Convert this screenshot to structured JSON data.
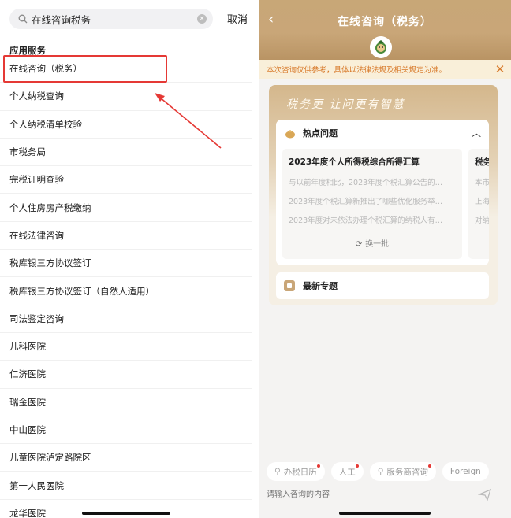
{
  "search": {
    "query": "在线咨询税务",
    "cancel_label": "取消"
  },
  "results": {
    "section_title": "应用服务",
    "items": [
      "在线咨询（税务）",
      "个人纳税查询",
      "个人纳税清单校验",
      "市税务局",
      "完税证明查验",
      "个人住房房产税缴纳",
      "在线法律咨询",
      "税库银三方协议签订",
      "税库银三方协议签订（自然人适用）",
      "司法鉴定咨询",
      "儿科医院",
      "仁济医院",
      "瑞金医院",
      "中山医院",
      "儿童医院泸定路院区",
      "第一人民医院",
      "龙华医院"
    ]
  },
  "chat": {
    "title": "在线咨询（税务）",
    "notice": "本次咨询仅供参考，具体以法律法规及相关规定为准。",
    "slogan": "税务更 让问更有智慧",
    "hot": {
      "title": "热点问题",
      "question_head": "2023年度个人所得税综合所得汇算",
      "questions": [
        "与以前年度相比，2023年度个税汇算公告的…",
        "2023年度个税汇算新推出了哪些优化服务举…",
        "2023年度对未依法办理个税汇算的纳税人有…"
      ],
      "refresh_label": "换一批",
      "second_head": "税务",
      "second_lines": [
        "本市",
        "上海",
        "对纳"
      ]
    },
    "topic_title": "最新专题",
    "chips": [
      "办税日历",
      "人工",
      "服务商咨询",
      "Foreign"
    ],
    "input_placeholder": "请输入咨询的内容"
  },
  "colors": {
    "header_gold": "#c9a678",
    "highlight_red": "#e53935",
    "notice_orange": "#d87a2a"
  },
  "icons": [
    "search-icon",
    "clear-icon",
    "back-icon",
    "mascot-icon",
    "close-icon",
    "flame-icon",
    "chevron-up-icon",
    "refresh-icon",
    "topic-icon",
    "link-icon",
    "send-icon"
  ]
}
